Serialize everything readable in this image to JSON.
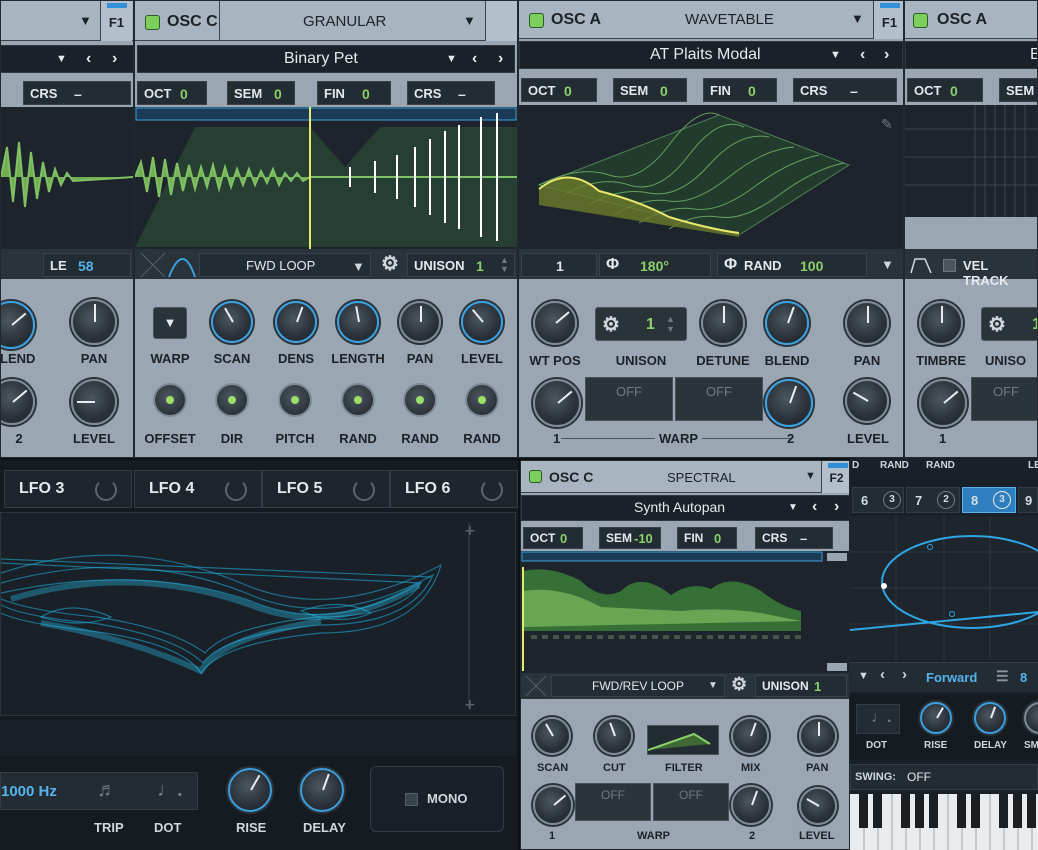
{
  "osc_c_granular": {
    "title": "OSC C",
    "type": "GRANULAR",
    "filter_tab": "F1",
    "preset": "Binary Pet",
    "oct_label": "OCT",
    "oct": "0",
    "sem_label": "SEM",
    "sem": "0",
    "fin_label": "FIN",
    "fin": "0",
    "crs_label": "CRS",
    "crs": "–",
    "loop_mode": "FWD LOOP",
    "unison_label": "UNISON",
    "unison": "1",
    "knob_labels": [
      "WARP",
      "SCAN",
      "DENS",
      "LENGTH",
      "PAN",
      "LEVEL"
    ],
    "knob_labels_2": [
      "OFFSET",
      "DIR",
      "PITCH",
      "RAND",
      "RAND",
      "RAND"
    ]
  },
  "left_partial": {
    "crs_label": "CRS",
    "crs": "–",
    "le_label": "LE",
    "le": "58",
    "knob_labels": [
      "BLEND",
      "PAN",
      "2",
      "LEVEL"
    ]
  },
  "osc_a_wavetable": {
    "title": "OSC A",
    "type": "WAVETABLE",
    "filter_tab": "F1",
    "preset": "AT Plaits Modal",
    "oct_label": "OCT",
    "oct": "0",
    "sem_label": "SEM",
    "sem": "0",
    "fin_label": "FIN",
    "fin": "0",
    "crs_label": "CRS",
    "crs": "–",
    "frame": "1",
    "phase": "180°",
    "phase_icon": "Φ",
    "rand_label": "RAND",
    "rand": "100",
    "unison_label": "UNISON",
    "unison": "1",
    "knob_labels": [
      "WT POS",
      "UNISON",
      "DETUNE",
      "BLEND",
      "PAN"
    ],
    "warp_off_1": "OFF",
    "warp_off_2": "OFF",
    "warp_label": "WARP",
    "warp_1": "1",
    "warp_2": "2",
    "level_label": "LEVEL"
  },
  "osc_a_right": {
    "title": "OSC A",
    "oct_label": "OCT",
    "oct": "0",
    "sem_label": "SEM",
    "vel_track": "VEL TRACK",
    "timbre": "TIMBRE",
    "unison": "UNISO",
    "unison_val": "1",
    "warp_off": "OFF",
    "warp_1": "1",
    "preset_initial": "B"
  },
  "lfo_tabs": [
    "LFO 3",
    "LFO 4",
    "LFO 5",
    "LFO 6"
  ],
  "lfo_footer": {
    "rate": "1000 Hz",
    "trip": "TRIP",
    "dot": "DOT",
    "rise": "RISE",
    "delay": "DELAY",
    "mono": "MONO"
  },
  "osc_c_spectral": {
    "title": "OSC C",
    "type": "SPECTRAL",
    "filter_tab": "F2",
    "preset": "Synth Autopan",
    "oct_label": "OCT",
    "oct": "0",
    "sem_label": "SEM",
    "sem": "-10",
    "fin_label": "FIN",
    "fin": "0",
    "crs_label": "CRS",
    "crs": "–",
    "loop_mode": "FWD/REV LOOP",
    "unison_label": "UNISON",
    "unison": "1",
    "knob_labels": [
      "SCAN",
      "CUT",
      "FILTER",
      "MIX",
      "PAN"
    ],
    "warp_off_1": "OFF",
    "warp_off_2": "OFF",
    "warp_label": "WARP",
    "warp_1": "1",
    "warp_2": "2",
    "level_label": "LEVEL"
  },
  "seq_panel": {
    "rand_labels": [
      "D",
      "RAND",
      "RAND"
    ],
    "steps": [
      {
        "n": "6",
        "c": "3"
      },
      {
        "n": "7",
        "c": "2"
      },
      {
        "n": "8",
        "c": "3"
      },
      {
        "n": "9",
        "c": ""
      }
    ],
    "mode": "Forward",
    "count": "8",
    "dot": "DOT",
    "rise": "RISE",
    "delay": "DELAY",
    "sm": "SM",
    "swing_label": "SWING:",
    "swing": "OFF",
    "top_partial": "LE"
  }
}
